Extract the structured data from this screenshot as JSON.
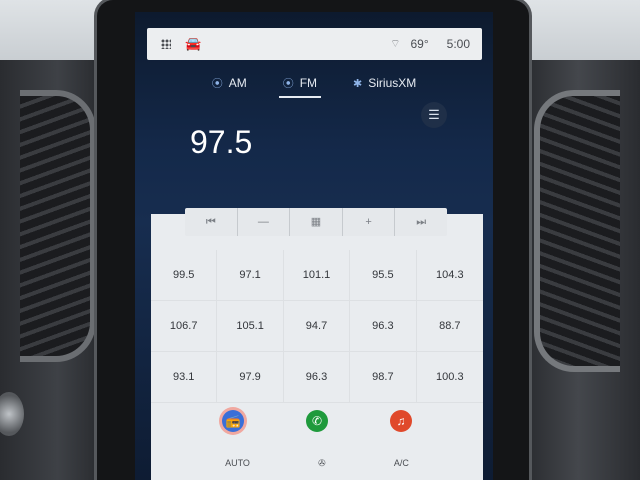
{
  "status": {
    "temperature": "69°",
    "time": "5:00"
  },
  "bands": [
    {
      "label": "AM",
      "icon": "antenna-icon"
    },
    {
      "label": "FM",
      "icon": "antenna-icon"
    },
    {
      "label": "SiriusXM",
      "icon": "siriusxm-icon"
    }
  ],
  "now_playing": {
    "frequency": "97.5"
  },
  "controls": [
    {
      "name": "seek-back",
      "glyph": "⏮"
    },
    {
      "name": "tune-down",
      "glyph": "—"
    },
    {
      "name": "presets",
      "glyph": "▦"
    },
    {
      "name": "tune-up",
      "glyph": "+"
    },
    {
      "name": "seek-forward",
      "glyph": "⏭"
    }
  ],
  "presets": [
    "99.5",
    "97.1",
    "101.1",
    "95.5",
    "104.3",
    "106.7",
    "105.1",
    "94.7",
    "96.3",
    "88.7",
    "93.1",
    "97.9",
    "96.3",
    "98.7",
    "100.3"
  ],
  "dock": [
    {
      "name": "radio",
      "glyph": "📻"
    },
    {
      "name": "phone",
      "glyph": "✆"
    },
    {
      "name": "music",
      "glyph": "♫"
    }
  ],
  "climate": {
    "left": "AUTO",
    "right": "A/C"
  },
  "colors": {
    "active_band_underline": "#e6ebf2",
    "phone_green": "#1f9a3c",
    "music_red": "#e0492b"
  }
}
